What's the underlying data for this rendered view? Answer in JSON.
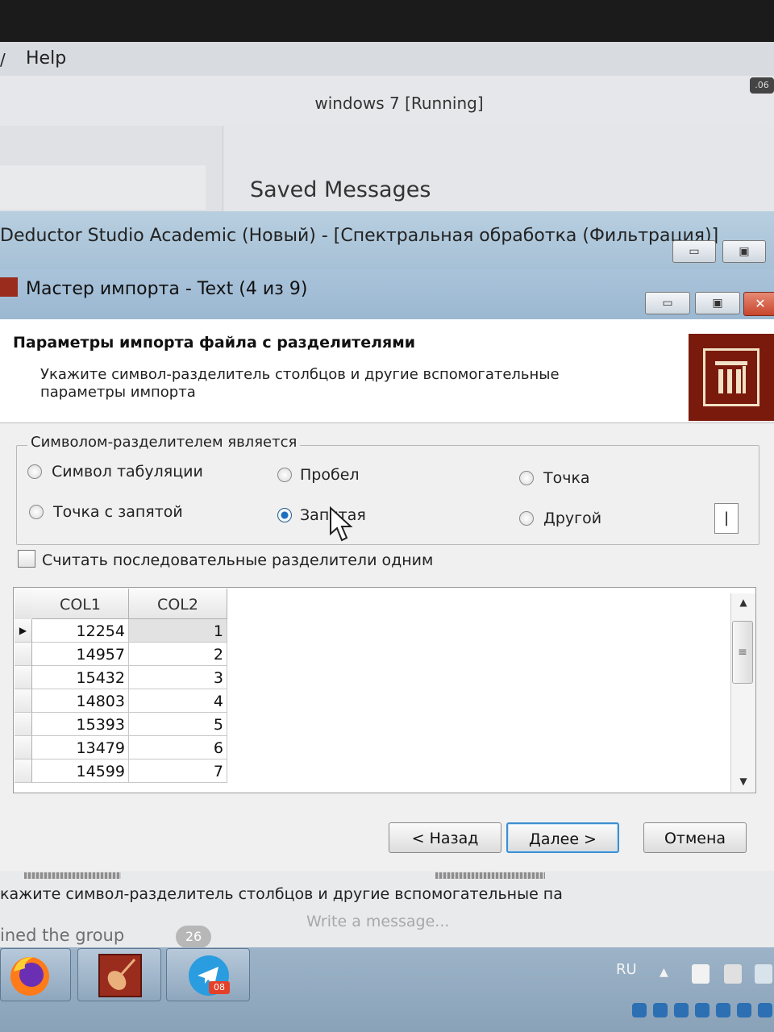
{
  "host": {
    "menu_partial": "/",
    "menu_help": "Help",
    "window_title": "windows 7 [Running]",
    "chip": ".06"
  },
  "chat": {
    "title": "Saved Messages",
    "message_preview": "кажите символ-разделитель столбцов и другие вспомогательные па",
    "joined_text": "ined the group",
    "badge_count": "26",
    "input_placeholder": "Write a message..."
  },
  "deductor": {
    "window_title": "Deductor Studio Academic (Новый) - [Спектральная обработка (Фильтрация)]"
  },
  "wizard": {
    "title": "Мастер импорта - Text (4 из 9)",
    "heading": "Параметры импорта файла с разделителями",
    "description": "Укажите символ-разделитель столбцов и другие вспомогательные параметры импорта",
    "separator_group": {
      "legend": "Символом-разделителем является",
      "options": [
        {
          "label": "Символ табуляции",
          "checked": false
        },
        {
          "label": "Пробел",
          "checked": false
        },
        {
          "label": "Точка",
          "checked": false
        },
        {
          "label": "Точка с запятой",
          "checked": false
        },
        {
          "label": "Запятая",
          "checked": true
        },
        {
          "label": "Другой",
          "checked": false
        }
      ],
      "other_value": "|"
    },
    "consecutive_checkbox": {
      "label": "Считать последовательные разделители одним",
      "checked": false
    },
    "grid": {
      "columns": [
        "COL1",
        "COL2"
      ],
      "rows": [
        [
          "12254",
          "1"
        ],
        [
          "14957",
          "2"
        ],
        [
          "15432",
          "3"
        ],
        [
          "14803",
          "4"
        ],
        [
          "15393",
          "5"
        ],
        [
          "13479",
          "6"
        ],
        [
          "14599",
          "7"
        ]
      ],
      "current_row_marker": "▶"
    },
    "buttons": {
      "back": "< Назад",
      "next": "Далее >",
      "cancel": "Отмена"
    }
  },
  "taskbar": {
    "lang": "RU",
    "telegram_badge": "08"
  },
  "colors": {
    "title_bar": "#a9c3da",
    "dialog_bg": "#f0f0f0",
    "accent_focus": "#3c8fd0",
    "brand": "#7a1a0c",
    "close_button": "#c8452d"
  }
}
